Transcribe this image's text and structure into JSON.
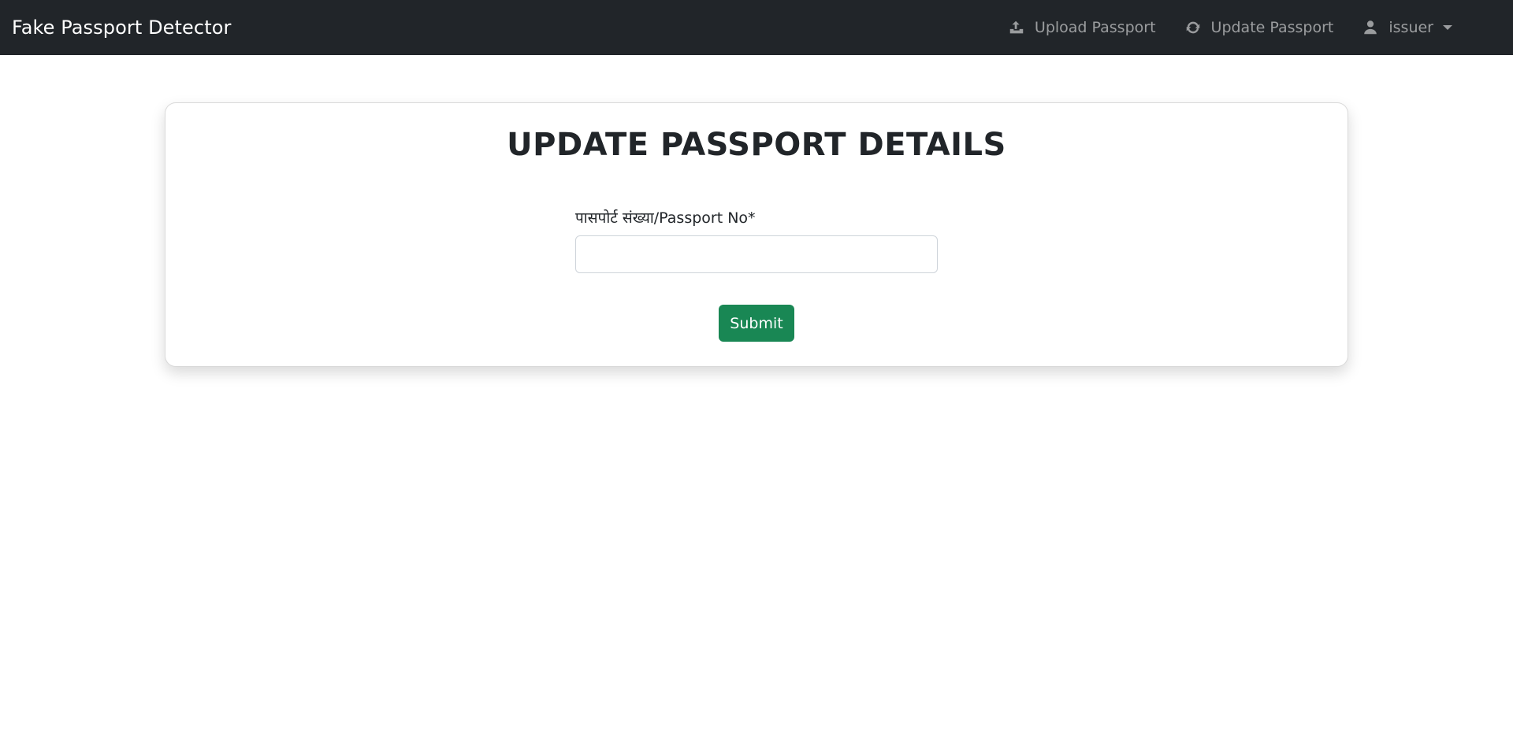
{
  "navbar": {
    "brand": "Fake Passport Detector",
    "links": [
      {
        "label": "Upload Passport",
        "icon": "upload-icon"
      },
      {
        "label": "Update Passport",
        "icon": "refresh-icon"
      }
    ],
    "user": {
      "label": "issuer",
      "icon": "user-icon"
    }
  },
  "form": {
    "title": "UPDATE PASSPORT DETAILS",
    "passport_label": "पासपोर्ट संख्या/Passport No*",
    "passport_value": "",
    "passport_placeholder": "",
    "submit_label": "Submit"
  },
  "colors": {
    "navbar_bg": "#212529",
    "submit_bg": "#198754"
  }
}
